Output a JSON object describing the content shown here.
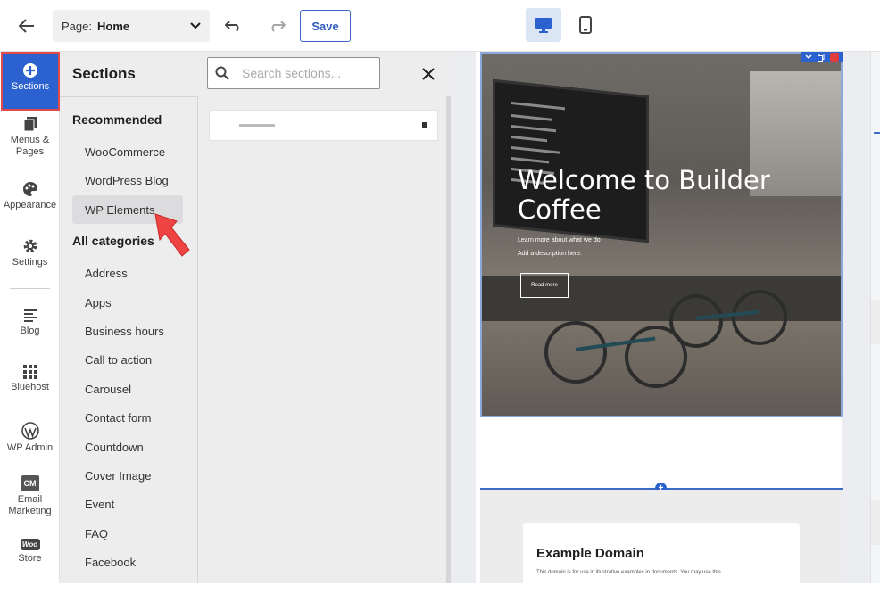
{
  "topbar": {
    "page_label": "Page:",
    "page_value": "Home",
    "save_label": "Save"
  },
  "rail": {
    "items": [
      {
        "label": "Sections",
        "icon": "plus-circle-icon"
      },
      {
        "label": "Menus &",
        "label2": "Pages",
        "icon": "pages-icon"
      },
      {
        "label": "Appearance",
        "icon": "palette-icon"
      },
      {
        "label": "Settings",
        "icon": "gear-icon"
      },
      {
        "label": "Blog",
        "icon": "blog-icon"
      },
      {
        "label": "Bluehost",
        "icon": "grid-icon"
      },
      {
        "label": "WP Admin",
        "icon": "wordpress-icon"
      },
      {
        "label": "Email",
        "label2": "Marketing",
        "icon": "cm-icon",
        "badge": "CM"
      },
      {
        "label": "Store",
        "icon": "woo-icon",
        "badge": "Woo"
      }
    ]
  },
  "panel": {
    "title": "Sections",
    "search_placeholder": "Search sections...",
    "recommended_heading": "Recommended",
    "recommended": [
      "WooCommerce",
      "WordPress Blog",
      "WP Elements"
    ],
    "all_heading": "All categories",
    "categories": [
      "Address",
      "Apps",
      "Business hours",
      "Call to action",
      "Carousel",
      "Contact form",
      "Countdown",
      "Cover Image",
      "Event",
      "FAQ",
      "Facebook"
    ]
  },
  "canvas": {
    "hero_title": "Welcome to Builder Coffee",
    "hero_sub1": "Learn more about what we do",
    "hero_sub2": "Add a description here.",
    "hero_button": "Read more",
    "domain_title": "Example Domain",
    "domain_text": "This domain is for use in illustrative examples in documents. You may use this"
  },
  "colors": {
    "accent": "#2c62cf",
    "highlight_border": "#e34a4a",
    "pointer": "#ef4444"
  }
}
